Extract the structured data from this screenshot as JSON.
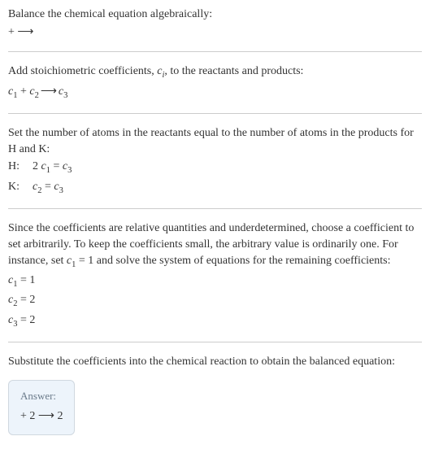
{
  "section1": {
    "line1": "Balance the chemical equation algebraically:",
    "line2": " +  ⟶"
  },
  "section2": {
    "line1": "Add stoichiometric coefficients, ",
    "ci_var": "c",
    "ci_sub": "i",
    "line1_tail": ", to the reactants and products:",
    "eq_c1": "c",
    "eq_c1_sub": "1",
    "plus": " + ",
    "eq_c2": "c",
    "eq_c2_sub": "2",
    "arrow": "  ⟶ ",
    "eq_c3": "c",
    "eq_c3_sub": "3"
  },
  "section3": {
    "intro": "Set the number of atoms in the reactants equal to the number of atoms in the products for H and K:",
    "rows": [
      {
        "label": "H:",
        "lhs_coeff": "2 ",
        "lhs_c": "c",
        "lhs_sub": "1",
        "eq": " = ",
        "rhs_c": "c",
        "rhs_sub": "3"
      },
      {
        "label": "K:",
        "lhs_coeff": "",
        "lhs_c": "c",
        "lhs_sub": "2",
        "eq": " = ",
        "rhs_c": "c",
        "rhs_sub": "3"
      }
    ]
  },
  "section4": {
    "p_part1": "Since the coefficients are relative quantities and underdetermined, choose a coefficient to set arbitrarily. To keep the coefficients small, the arbitrary value is ordinarily one. For instance, set ",
    "set_c": "c",
    "set_sub": "1",
    "set_eq": " = 1",
    "p_part2": " and solve the system of equations for the remaining coefficients:",
    "solutions": [
      {
        "c": "c",
        "sub": "1",
        "val": " = 1"
      },
      {
        "c": "c",
        "sub": "2",
        "val": " = 2"
      },
      {
        "c": "c",
        "sub": "3",
        "val": " = 2"
      }
    ]
  },
  "section5": {
    "text": "Substitute the coefficients into the chemical reaction to obtain the balanced equation:"
  },
  "answer": {
    "title": "Answer:",
    "equation": " + 2  ⟶ 2"
  }
}
